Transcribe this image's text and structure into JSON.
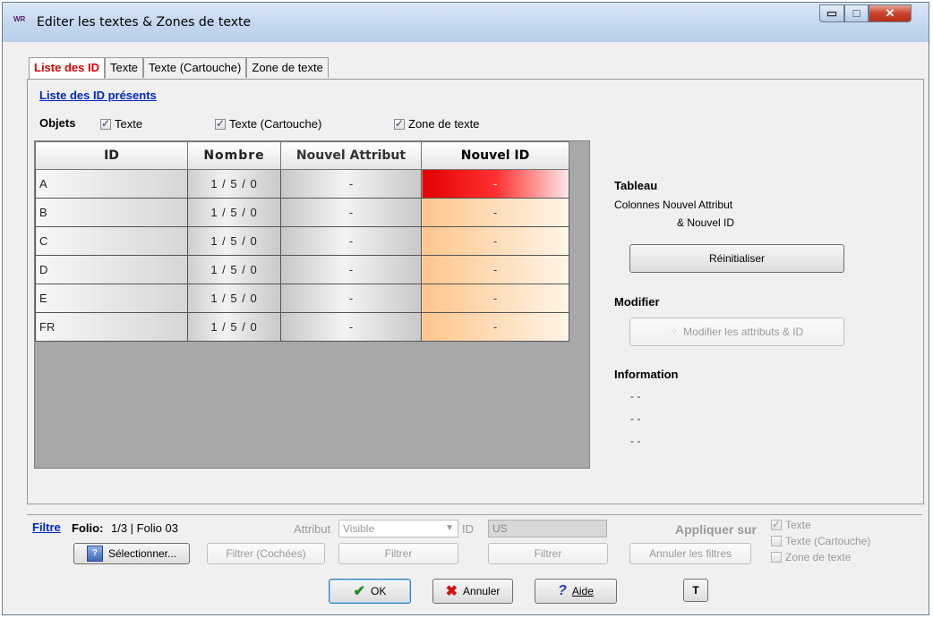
{
  "window": {
    "title": "Editer les textes & Zones de texte",
    "app_icon_text": "WR",
    "minimize_glyph": "▭",
    "maximize_glyph": "□",
    "close_glyph": "✕"
  },
  "tabs": [
    {
      "label": "Liste des ID",
      "active": true
    },
    {
      "label": "Texte"
    },
    {
      "label": "Texte (Cartouche)"
    },
    {
      "label": "Zone de texte"
    }
  ],
  "list_section": {
    "title": "Liste des ID présents",
    "objets_label": "Objets",
    "checkboxes": [
      {
        "label": "Texte",
        "checked": true
      },
      {
        "label": "Texte (Cartouche)",
        "checked": true
      },
      {
        "label": "Zone de texte",
        "checked": true
      }
    ]
  },
  "table": {
    "headers": [
      "ID",
      "Nombre",
      "Nouvel Attribut",
      "Nouvel ID"
    ],
    "rows": [
      {
        "id": "A",
        "nombre": "1 / 5 / 0",
        "attribut": "-",
        "nouvel_id": "-",
        "selected": true
      },
      {
        "id": "B",
        "nombre": "1 / 5 / 0",
        "attribut": "-",
        "nouvel_id": "-"
      },
      {
        "id": "C",
        "nombre": "1 / 5 / 0",
        "attribut": "-",
        "nouvel_id": "-"
      },
      {
        "id": "D",
        "nombre": "1 / 5 / 0",
        "attribut": "-",
        "nouvel_id": "-"
      },
      {
        "id": "E",
        "nombre": "1 / 5 / 0",
        "attribut": "-",
        "nouvel_id": "-"
      },
      {
        "id": "FR",
        "nombre": "1 / 5 / 0",
        "attribut": "-",
        "nouvel_id": "-"
      }
    ]
  },
  "right_panel": {
    "tableau_heading": "Tableau",
    "tableau_text_1": "Colonnes Nouvel Attribut",
    "tableau_text_2": "& Nouvel ID",
    "reset_button": "Réinitialiser",
    "modifier_heading": "Modifier",
    "modifier_button": "Modifier les attributs & ID",
    "information_heading": "Information",
    "info_lines": [
      "- -",
      "- -",
      "- -"
    ]
  },
  "filter_bar": {
    "filtre_label": "Filtre",
    "folio_label": "Folio:",
    "folio_value": "1/3 | Folio 03",
    "select_button": "Sélectionner...",
    "attribut_label": "Attribut",
    "attribut_value": "Visible",
    "id_label": "ID",
    "id_value": "US",
    "filter_checked_button": "Filtrer (Cochées)",
    "filter_button_1": "Filtrer",
    "filter_button_2": "Filtrer",
    "apply_label": "Appliquer sur",
    "cancel_filters_button": "Annuler les filtres",
    "apply_checkboxes": [
      {
        "label": "Texte",
        "checked": true
      },
      {
        "label": "Texte (Cartouche)",
        "checked": false
      },
      {
        "label": "Zone de texte",
        "checked": false
      }
    ]
  },
  "footer": {
    "ok_label": "OK",
    "cancel_label": "Annuler",
    "help_label": "Aide",
    "extra_icon_text": "T"
  }
}
